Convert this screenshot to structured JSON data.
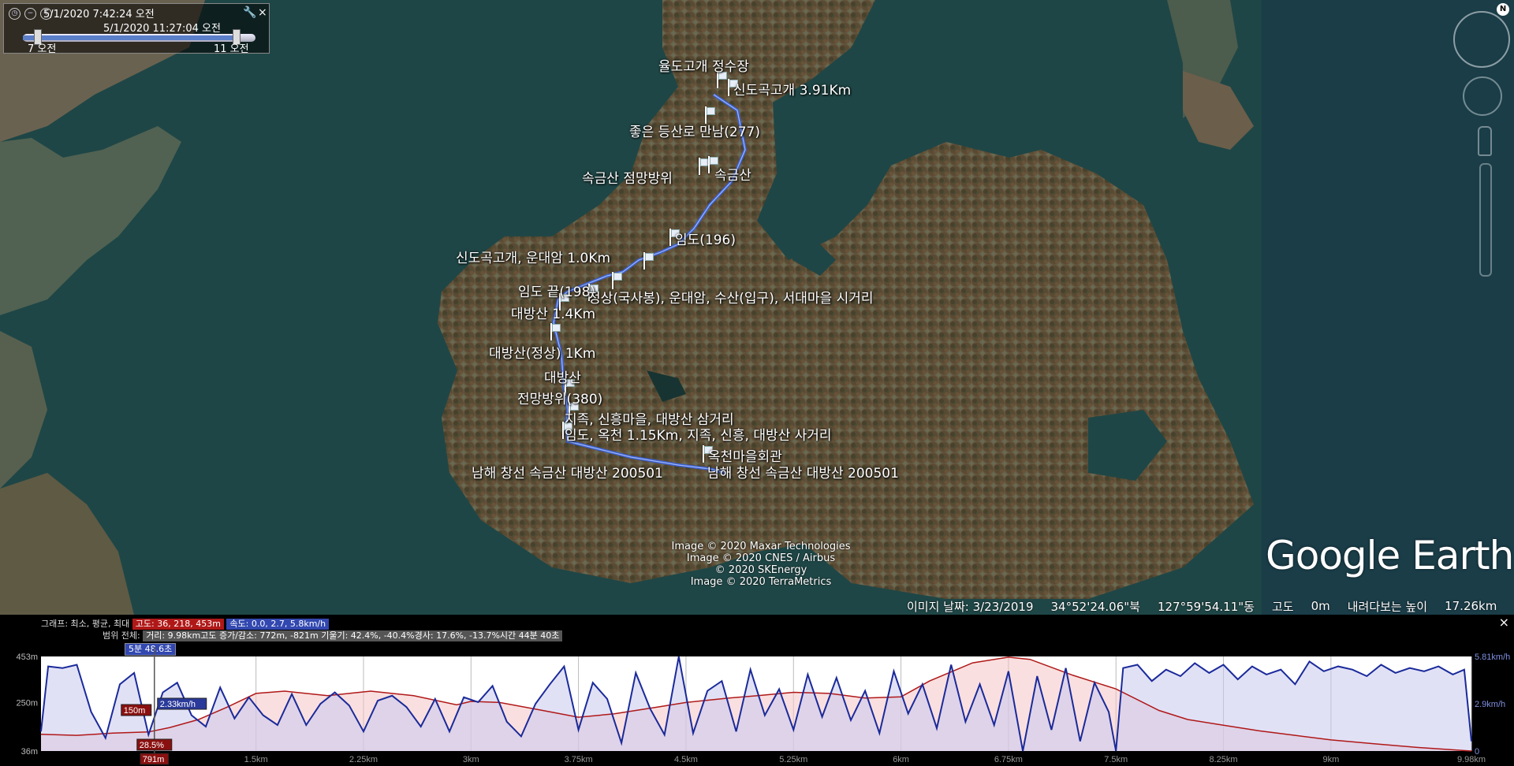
{
  "time_slider": {
    "start_time": "5/1/2020   7:42:24 오전",
    "end_time": "5/1/2020  11:27:04 오전",
    "left_label": "7 오전",
    "right_label": "11 오전"
  },
  "map": {
    "placemarks": [
      {
        "label": "율도고개 정수장"
      },
      {
        "label": "신도곡고개 3.91Km"
      },
      {
        "label": "좋은 등산로 만남(277)"
      },
      {
        "label": "속금산 점망방위"
      },
      {
        "label": "속금산"
      },
      {
        "label": "임도(196)"
      },
      {
        "label": "신도곡고개, 운대암 1.0Km"
      },
      {
        "label": "임도 끝(198)"
      },
      {
        "label": "정상(국사봉), 운대암, 수산(입구), 서대마을 시거리"
      },
      {
        "label": "대방산 1.4Km"
      },
      {
        "label": "대방산(정상) 1Km"
      },
      {
        "label": "대방산"
      },
      {
        "label": "전망방위(380)"
      },
      {
        "label": "지족, 신흥마을, 대방산 삼거리"
      },
      {
        "label": "임도, 옥천 1.15Km, 지족, 신흥, 대방산 사거리"
      },
      {
        "label": "옥천마을회관"
      },
      {
        "label": "남해 창선 속금산 대방산 200501"
      },
      {
        "label": "남해 창선 속금산 대방산 200501"
      }
    ],
    "credits": [
      "Image © 2020 Maxar Technologies",
      "Image © 2020 CNES / Airbus",
      "© 2020 SKEnergy",
      "Image © 2020 TerraMetrics"
    ],
    "logo_text": "Google Earth",
    "status": {
      "image_date": "이미지 날짜: 3/23/2019",
      "lat": "34°52'24.06\"북",
      "lon": "127°59'54.11\"동",
      "elev_label": "고도",
      "elev_value": "0m",
      "eye_alt_label": "내려다보는 높이",
      "eye_alt_value": "17.26km"
    },
    "compass_letter": "N",
    "colors": {
      "track": "#3a5fd0",
      "water": "#1f4a4a",
      "land": "#5a5a3e"
    }
  },
  "elevation_profile": {
    "header_line1_prefix": "그래프: 최소, 평균, 최대",
    "altitude_chip": "고도: 36, 218, 453m",
    "speed_chip": "속도: 0.0, 2.7, 5.8km/h",
    "header_line2_prefix": "범위 전체:",
    "stats_chip": "거리: 9.98km고도 증가/감소: 772m, -821m 기울기: 42.4%, -40.4%경사: 17.6%, -13.7%시간 44분 40초",
    "segment_time": "5분 48.6초",
    "cursor_elevation": "150m",
    "cursor_speed": "2.33km/h",
    "cursor_grade": "28.5%",
    "cursor_distance": "791m",
    "close_label": "×"
  },
  "chart_data": {
    "type": "area",
    "x_label_unit": "km",
    "x_ticks": [
      "1.5km",
      "2.25km",
      "3km",
      "3.75km",
      "4.5km",
      "5.25km",
      "6km",
      "6.75km",
      "7.5km",
      "8.25km",
      "9km",
      "9.98km"
    ],
    "x_tick_values": [
      1.5,
      2.25,
      3,
      3.75,
      4.5,
      5.25,
      6,
      6.75,
      7.5,
      8.25,
      9,
      9.98
    ],
    "xlim": [
      0,
      9.98
    ],
    "y_left_ticks": [
      "453m",
      "250m",
      "36m"
    ],
    "y_left_values": [
      453,
      250,
      36
    ],
    "y_left_lim": [
      36,
      453
    ],
    "y_right_ticks": [
      "5.81km/h",
      "2.9km/h",
      "0"
    ],
    "y_right_values": [
      5.81,
      2.9,
      0
    ],
    "y_right_lim": [
      0,
      5.81
    ],
    "cursor_x": 0.791,
    "series": [
      {
        "name": "고도",
        "axis": "left",
        "color": "#b01818",
        "fill": "#f4c4c4",
        "x": [
          0,
          0.25,
          0.5,
          0.75,
          0.9,
          1.1,
          1.3,
          1.5,
          1.7,
          2.0,
          2.3,
          2.6,
          2.9,
          3.0,
          3.2,
          3.5,
          3.75,
          4.0,
          4.3,
          4.5,
          4.8,
          5.0,
          5.25,
          5.5,
          5.75,
          6.0,
          6.2,
          6.5,
          6.75,
          6.9,
          7.2,
          7.5,
          7.8,
          8.0,
          8.25,
          8.5,
          8.75,
          9.0,
          9.3,
          9.6,
          9.98
        ],
        "y": [
          110,
          105,
          115,
          120,
          140,
          175,
          230,
          290,
          300,
          280,
          300,
          280,
          240,
          255,
          250,
          215,
          185,
          200,
          230,
          250,
          270,
          280,
          295,
          290,
          270,
          275,
          345,
          425,
          450,
          440,
          370,
          310,
          215,
          175,
          150,
          125,
          105,
          85,
          68,
          52,
          36
        ]
      },
      {
        "name": "속도",
        "axis": "right",
        "color": "#1a2a9a",
        "fill": "#c8c8ee",
        "x": [
          0,
          0.05,
          0.15,
          0.25,
          0.35,
          0.45,
          0.55,
          0.65,
          0.75,
          0.85,
          0.95,
          1.05,
          1.15,
          1.25,
          1.35,
          1.45,
          1.55,
          1.65,
          1.75,
          1.85,
          1.95,
          2.05,
          2.15,
          2.25,
          2.35,
          2.45,
          2.55,
          2.65,
          2.75,
          2.85,
          2.95,
          3.05,
          3.15,
          3.25,
          3.35,
          3.45,
          3.55,
          3.65,
          3.75,
          3.85,
          3.95,
          4.05,
          4.15,
          4.25,
          4.35,
          4.45,
          4.55,
          4.65,
          4.75,
          4.85,
          4.95,
          5.05,
          5.15,
          5.25,
          5.35,
          5.45,
          5.55,
          5.65,
          5.75,
          5.85,
          5.95,
          6.05,
          6.15,
          6.25,
          6.35,
          6.45,
          6.55,
          6.65,
          6.75,
          6.85,
          6.95,
          7.05,
          7.15,
          7.25,
          7.35,
          7.45,
          7.5,
          7.55,
          7.65,
          7.75,
          7.85,
          7.95,
          8.05,
          8.15,
          8.25,
          8.35,
          8.45,
          8.55,
          8.65,
          8.75,
          8.85,
          8.95,
          9.05,
          9.15,
          9.25,
          9.35,
          9.45,
          9.55,
          9.65,
          9.75,
          9.85,
          9.93,
          9.98
        ],
        "y": [
          1.2,
          5.2,
          5.1,
          5.3,
          2.4,
          0.8,
          4.1,
          4.8,
          1.0,
          3.6,
          4.2,
          2.2,
          1.5,
          3.9,
          2.0,
          3.3,
          2.2,
          1.6,
          3.5,
          1.6,
          2.9,
          3.6,
          2.8,
          1.2,
          3.1,
          3.4,
          2.7,
          1.5,
          3.2,
          1.2,
          3.3,
          3.0,
          4.0,
          1.8,
          0.9,
          2.9,
          4.1,
          5.2,
          1.3,
          4.2,
          3.2,
          0.5,
          4.8,
          2.6,
          1.0,
          5.8,
          1.1,
          3.7,
          4.3,
          1.2,
          5.0,
          2.2,
          3.8,
          1.3,
          4.7,
          2.1,
          4.5,
          1.9,
          3.7,
          1.1,
          4.9,
          2.3,
          4.1,
          1.4,
          5.3,
          1.8,
          4.1,
          1.6,
          4.9,
          0.0,
          4.6,
          1.3,
          5.1,
          0.6,
          4.2,
          2.4,
          0.0,
          5.1,
          5.3,
          4.3,
          5.0,
          4.6,
          5.4,
          4.8,
          5.3,
          4.4,
          5.2,
          4.7,
          5.0,
          4.1,
          5.5,
          4.9,
          5.2,
          5.0,
          4.6,
          5.3,
          4.8,
          5.1,
          4.9,
          5.2,
          4.7,
          5.0,
          0.6
        ]
      }
    ]
  }
}
